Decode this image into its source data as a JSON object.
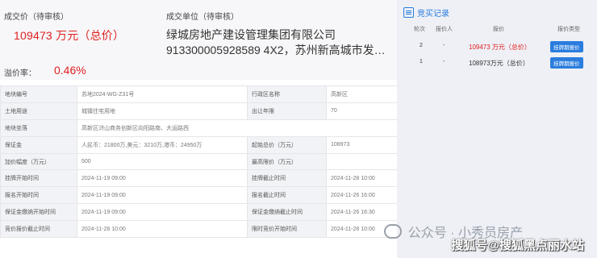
{
  "summary": {
    "price_label": "成交价（待审核）",
    "price_value": "109473 万元（总价）",
    "winner_label": "成交单位（待审核）",
    "winner_name": "绿城房地产建设管理集团有限公司",
    "winner_credit": "913300005928589 4X2，苏州新高城市发展...",
    "premium_label": "溢价率：",
    "premium_value": "0.46%"
  },
  "info_rows": [
    {
      "k1": "地块编号",
      "v1": "苏地2024-WG-Z31号",
      "k2": "行政区名称",
      "v2": "高新区"
    },
    {
      "k1": "土地用途",
      "v1": "城镇住宅用地",
      "k2": "出让年限",
      "v2": "70"
    },
    {
      "k1": "地块坐落",
      "v1": "高新区浒山商务创新区向阳路南、大运路西"
    },
    {
      "k1": "保证金",
      "v1": "人民币：21800万,美元：3210万,港币：24950万",
      "k2": "起始总价（万元）",
      "v2": "108973"
    },
    {
      "k1": "加价幅度（万元）",
      "v1": "500",
      "k2": "最高限价（万元）",
      "v2": ""
    },
    {
      "k1": "挂牌开始时间",
      "v1": "2024-11-19 09:00",
      "k2": "挂牌截止时间",
      "v2": "2024-11-28 10:00"
    },
    {
      "k1": "报名开始时间",
      "v1": "2024-11-19 09:00",
      "k2": "报名截止时间",
      "v2": "2024-11-26 16:00"
    },
    {
      "k1": "保证金缴纳开始时间",
      "v1": "2024-11-19 09:00",
      "k2": "保证金缴纳截止时间",
      "v2": "2024-11-26 16:30"
    },
    {
      "k1": "竞价报价截止时间",
      "v1": "2024-11-28 10:00",
      "k2": "限时竞价开始时间",
      "v2": "2024-11-28 10:00"
    }
  ],
  "bids": {
    "title": "竞买记录",
    "col_round": "轮次",
    "col_bidder": "报价人",
    "col_price": "报价",
    "col_type": "报价类型",
    "rows": [
      {
        "round": "2",
        "bidder": "-",
        "price": "109473 万元（总价）",
        "type": "挂牌期报价",
        "highlight": true
      },
      {
        "round": "1",
        "bidder": "-",
        "price": "108973万元（总价）",
        "type": "挂牌期报价",
        "highlight": false
      }
    ]
  },
  "watermarks": {
    "wechat": "公众号 · 小秀员房产",
    "sohu": "搜狐号@搜狐黑点丽水站"
  }
}
